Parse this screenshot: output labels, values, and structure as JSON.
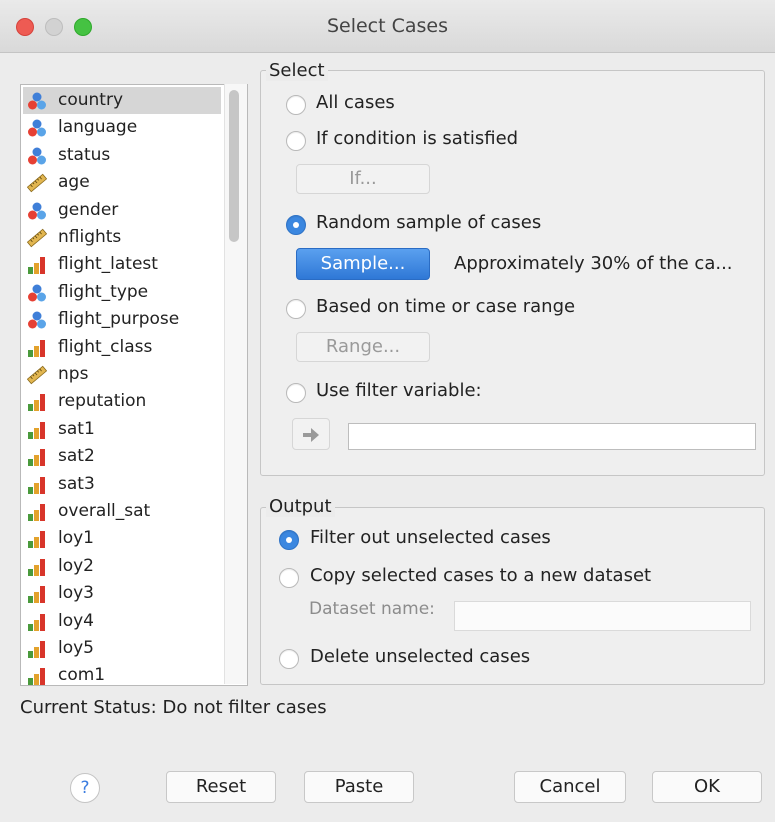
{
  "window": {
    "title": "Select Cases"
  },
  "variables": [
    {
      "label": "country",
      "icon": "nominal-icon"
    },
    {
      "label": "language",
      "icon": "nominal-icon"
    },
    {
      "label": "status",
      "icon": "nominal-icon"
    },
    {
      "label": "age",
      "icon": "scale-icon"
    },
    {
      "label": "gender",
      "icon": "nominal-icon"
    },
    {
      "label": "nflights",
      "icon": "scale-icon"
    },
    {
      "label": "flight_latest",
      "icon": "ordinal-icon"
    },
    {
      "label": "flight_type",
      "icon": "nominal-icon"
    },
    {
      "label": "flight_purpose",
      "icon": "nominal-icon"
    },
    {
      "label": "flight_class",
      "icon": "ordinal-icon"
    },
    {
      "label": "nps",
      "icon": "scale-icon"
    },
    {
      "label": "reputation",
      "icon": "ordinal-icon"
    },
    {
      "label": "sat1",
      "icon": "ordinal-icon"
    },
    {
      "label": "sat2",
      "icon": "ordinal-icon"
    },
    {
      "label": "sat3",
      "icon": "ordinal-icon"
    },
    {
      "label": "overall_sat",
      "icon": "ordinal-icon"
    },
    {
      "label": "loy1",
      "icon": "ordinal-icon"
    },
    {
      "label": "loy2",
      "icon": "ordinal-icon"
    },
    {
      "label": "loy3",
      "icon": "ordinal-icon"
    },
    {
      "label": "loy4",
      "icon": "ordinal-icon"
    },
    {
      "label": "loy5",
      "icon": "ordinal-icon"
    },
    {
      "label": "com1",
      "icon": "ordinal-icon"
    }
  ],
  "select_group": {
    "legend": "Select",
    "all_cases": "All cases",
    "if_condition": "If condition is satisfied",
    "if_button": "If...",
    "random_sample": "Random sample of cases",
    "sample_button": "Sample...",
    "sample_info": "Approximately 30% of the ca...",
    "time_range": "Based on time or case range",
    "range_button": "Range...",
    "filter_variable": "Use filter variable:",
    "filter_value": "",
    "selected_option": "random_sample"
  },
  "output_group": {
    "legend": "Output",
    "filter_out": "Filter out unselected cases",
    "copy_dataset": "Copy selected cases to a new dataset",
    "dataset_name_label": "Dataset name:",
    "dataset_name_value": "",
    "delete_unselected": "Delete unselected cases",
    "selected_option": "filter_out"
  },
  "status": {
    "text": "Current Status: Do not filter cases"
  },
  "buttons": {
    "help": "?",
    "reset": "Reset",
    "paste": "Paste",
    "cancel": "Cancel",
    "ok": "OK"
  },
  "colors": {
    "accent": "#3b87e0",
    "close": "#ee5b53",
    "maximize": "#45c242"
  }
}
